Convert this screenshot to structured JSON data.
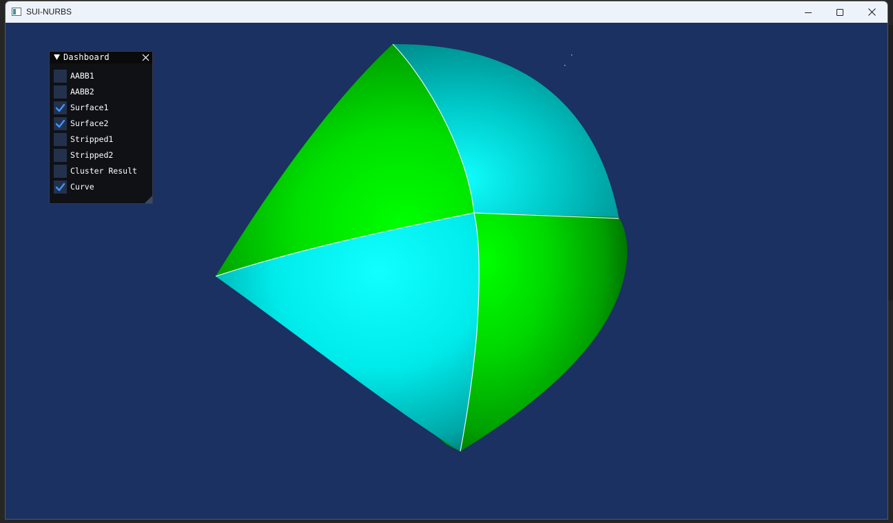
{
  "window": {
    "title": "SUI-NURBS",
    "controls": {
      "minimize": "minimize-icon",
      "maximize": "maximize-icon",
      "close": "close-icon"
    }
  },
  "viewport": {
    "background_color": "#1a3161",
    "surface_colors": {
      "surface1": "#00e600",
      "surface2": "#00f0f0",
      "curve": "#e8f0f0"
    }
  },
  "dashboard": {
    "title": "Dashboard",
    "collapse_icon": "triangle-down-icon",
    "close_icon": "close-icon",
    "checkbox_color": "#23314d",
    "check_color": "#4296fa",
    "items": [
      {
        "label": "AABB1",
        "checked": false
      },
      {
        "label": "AABB2",
        "checked": false
      },
      {
        "label": "Surface1",
        "checked": true
      },
      {
        "label": "Surface2",
        "checked": true
      },
      {
        "label": "Stripped1",
        "checked": false
      },
      {
        "label": "Stripped2",
        "checked": false
      },
      {
        "label": "Cluster Result",
        "checked": false
      },
      {
        "label": "Curve",
        "checked": true
      }
    ]
  }
}
